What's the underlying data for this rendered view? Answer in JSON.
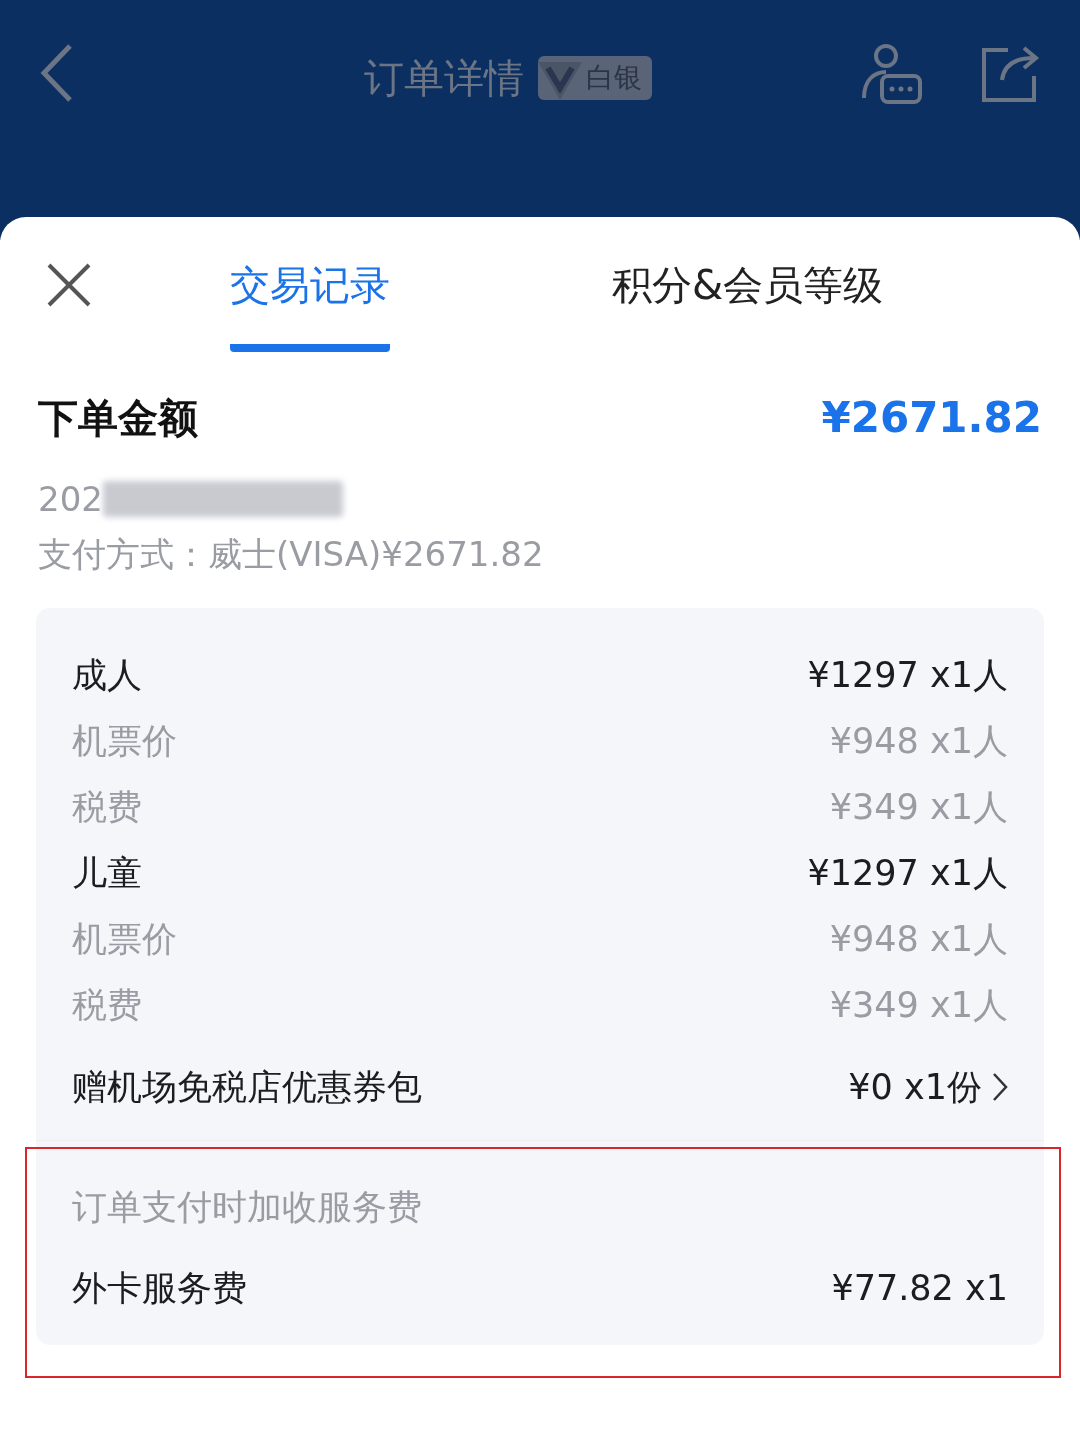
{
  "header": {
    "title": "订单详情",
    "badge": "白银"
  },
  "tabs": [
    {
      "label": "交易记录",
      "selected": true
    },
    {
      "label": "积分&会员等级",
      "selected": false
    }
  ],
  "summary": {
    "label": "下单金额",
    "amount": "¥2671.82",
    "date": "202",
    "payment": "支付方式：威士(VISA)¥2671.82"
  },
  "breakdown": [
    {
      "kind": "main",
      "label": "成人",
      "value": "¥1297 x1人"
    },
    {
      "kind": "sub",
      "label": "机票价",
      "value": "¥948 x1人"
    },
    {
      "kind": "sub",
      "label": "税费",
      "value": "¥349 x1人"
    },
    {
      "kind": "main",
      "label": "儿童",
      "value": "¥1297 x1人"
    },
    {
      "kind": "sub",
      "label": "机票价",
      "value": "¥948 x1人"
    },
    {
      "kind": "sub",
      "label": "税费",
      "value": "¥349 x1人"
    },
    {
      "kind": "link",
      "label": "赠机场免税店优惠券包",
      "value": "¥0 x1份"
    }
  ],
  "fees": {
    "note": "订单支付时加收服务费",
    "rows": [
      {
        "kind": "main",
        "label": "外卡服务费",
        "value": "¥77.82 x1"
      }
    ]
  }
}
